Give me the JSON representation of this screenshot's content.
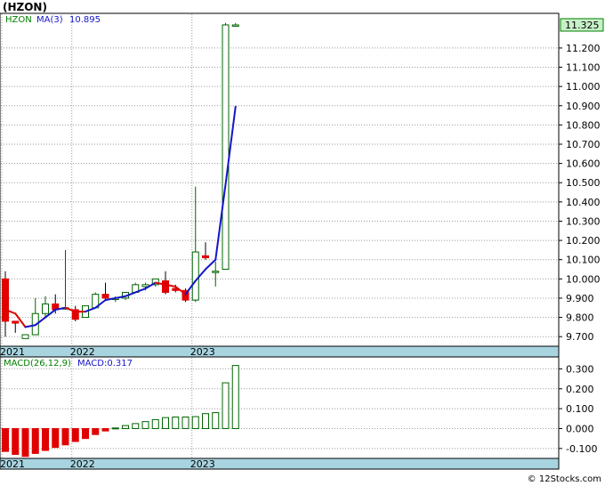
{
  "title": "(HZON)",
  "footer": "© 12Stocks.com",
  "colors": {
    "up_fill": "#ffffff",
    "up_stroke": "#006400",
    "down_fill": "#e00000",
    "ma_line": "#1515c8",
    "ma_down": "#e00000",
    "band": "#a8d4e0",
    "price_tag": "#c8f0c8",
    "legend_ticker": "#008000",
    "legend_ma": "#1515c8",
    "grid": "#999999"
  },
  "chart_data": [
    {
      "type": "candlestick",
      "title": "(HZON)",
      "legend": [
        {
          "text": "HZON",
          "color_key": "legend_ticker"
        },
        {
          "text": "MA(3)",
          "color_key": "legend_ma"
        },
        {
          "text": "10.895",
          "color_key": "legend_ma"
        }
      ],
      "last_price_label": "11.325",
      "ylim": [
        9.65,
        11.38
      ],
      "yticks": [
        "11.200",
        "11.100",
        "11.000",
        "10.900",
        "10.800",
        "10.700",
        "10.600",
        "10.500",
        "10.400",
        "10.300",
        "10.200",
        "10.100",
        "10.000",
        "9.900",
        "9.800",
        "9.700"
      ],
      "xtick_labels": [
        {
          "label": "2021",
          "index": 0
        },
        {
          "label": "2022",
          "index": 7
        },
        {
          "label": "2023",
          "index": 19
        }
      ],
      "candles": [
        {
          "o": 10.0,
          "h": 10.04,
          "l": 9.7,
          "c": 9.78
        },
        {
          "o": 9.78,
          "h": 9.78,
          "l": 9.72,
          "c": 9.77
        },
        {
          "o": 9.69,
          "h": 9.71,
          "l": 9.69,
          "c": 9.71
        },
        {
          "o": 9.71,
          "h": 9.9,
          "l": 9.71,
          "c": 9.82
        },
        {
          "o": 9.82,
          "h": 9.91,
          "l": 9.8,
          "c": 9.87
        },
        {
          "o": 9.87,
          "h": 9.92,
          "l": 9.82,
          "c": 9.84
        },
        {
          "o": 9.85,
          "h": 10.15,
          "l": 9.84,
          "c": 9.85
        },
        {
          "o": 9.84,
          "h": 9.86,
          "l": 9.78,
          "c": 9.79
        },
        {
          "o": 9.8,
          "h": 9.86,
          "l": 9.8,
          "c": 9.86
        },
        {
          "o": 9.85,
          "h": 9.93,
          "l": 9.85,
          "c": 9.92
        },
        {
          "o": 9.92,
          "h": 9.98,
          "l": 9.89,
          "c": 9.9
        },
        {
          "o": 9.9,
          "h": 9.91,
          "l": 9.88,
          "c": 9.9
        },
        {
          "o": 9.9,
          "h": 9.93,
          "l": 9.89,
          "c": 9.93
        },
        {
          "o": 9.93,
          "h": 9.98,
          "l": 9.93,
          "c": 9.97
        },
        {
          "o": 9.96,
          "h": 9.98,
          "l": 9.94,
          "c": 9.97
        },
        {
          "o": 9.97,
          "h": 10.0,
          "l": 9.96,
          "c": 10.0
        },
        {
          "o": 9.99,
          "h": 10.04,
          "l": 9.92,
          "c": 9.93
        },
        {
          "o": 9.95,
          "h": 9.97,
          "l": 9.93,
          "c": 9.94
        },
        {
          "o": 9.94,
          "h": 9.95,
          "l": 9.88,
          "c": 9.89
        },
        {
          "o": 9.89,
          "h": 10.48,
          "l": 9.88,
          "c": 10.14
        },
        {
          "o": 10.12,
          "h": 10.19,
          "l": 10.1,
          "c": 10.11
        },
        {
          "o": 10.04,
          "h": 10.09,
          "l": 9.96,
          "c": 10.04
        },
        {
          "o": 10.05,
          "h": 11.33,
          "l": 10.05,
          "c": 11.32
        },
        {
          "o": 11.32,
          "h": 11.33,
          "l": 11.31,
          "c": 11.32
        }
      ],
      "ma": [
        9.84,
        9.82,
        9.75,
        9.76,
        9.8,
        9.84,
        9.85,
        9.83,
        9.83,
        9.85,
        9.89,
        9.9,
        9.91,
        9.93,
        9.95,
        9.98,
        9.97,
        9.96,
        9.92,
        9.99,
        10.05,
        10.1,
        10.49,
        10.895
      ],
      "ma_direction": [
        "down",
        "down",
        "down",
        "up",
        "up",
        "up",
        "up",
        "down",
        "down",
        "up",
        "up",
        "up",
        "up",
        "up",
        "up",
        "up",
        "down",
        "down",
        "down",
        "up",
        "up",
        "up",
        "up",
        "up"
      ]
    },
    {
      "type": "bar",
      "title": "MACD(26,12,9)",
      "legend": [
        {
          "text": "MACD(26,12,9)",
          "color_key": "legend_ticker"
        },
        {
          "text": "MACD:0.317",
          "color_key": "legend_ma"
        }
      ],
      "ylim": [
        -0.15,
        0.36
      ],
      "yticks": [
        "0.300",
        "0.200",
        "0.100",
        "0.000",
        "-0.100"
      ],
      "xtick_labels": [
        {
          "label": "2021",
          "index": 0
        },
        {
          "label": "2022",
          "index": 7
        },
        {
          "label": "2023",
          "index": 19
        }
      ],
      "values": [
        -0.115,
        -0.13,
        -0.14,
        -0.125,
        -0.11,
        -0.095,
        -0.082,
        -0.065,
        -0.05,
        -0.03,
        -0.012,
        0.003,
        0.015,
        0.025,
        0.035,
        0.045,
        0.055,
        0.058,
        0.058,
        0.06,
        0.075,
        0.08,
        0.23,
        0.317
      ]
    }
  ]
}
